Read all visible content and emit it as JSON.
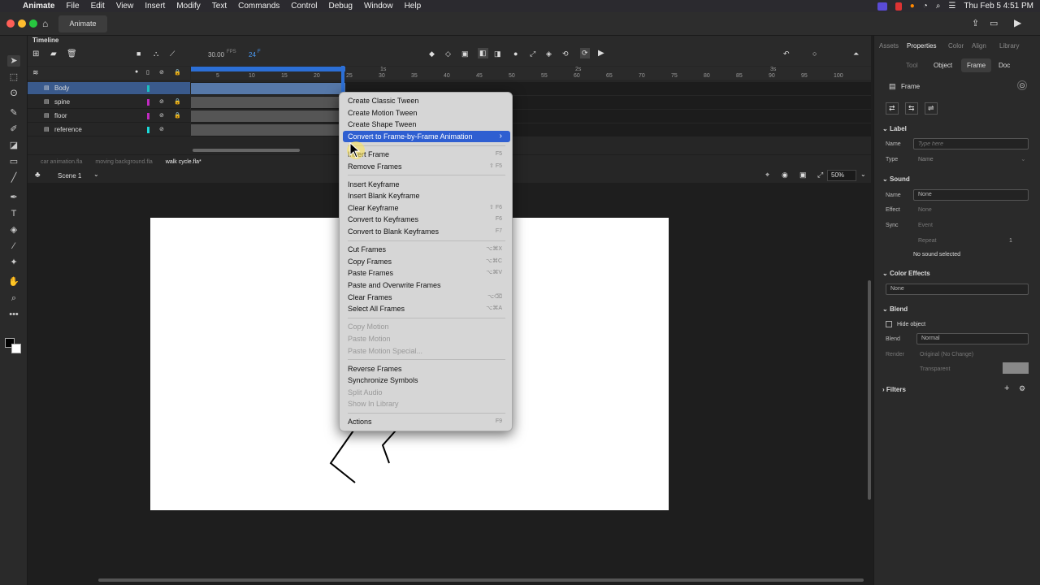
{
  "menubar": {
    "app": "Animate",
    "items": [
      "File",
      "Edit",
      "View",
      "Insert",
      "Modify",
      "Text",
      "Commands",
      "Control",
      "Debug",
      "Window",
      "Help"
    ],
    "datetime": "Thu Feb 5  4:51 PM"
  },
  "titlebar": {
    "tab": "Animate"
  },
  "timeline": {
    "title": "Timeline",
    "fps": "30.00",
    "fps_unit": "FPS",
    "frame": "24",
    "frame_unit": "F",
    "ruler": [
      "5",
      "10",
      "15",
      "20",
      "25",
      "30",
      "35",
      "40",
      "45",
      "50",
      "55",
      "60",
      "65",
      "70",
      "75",
      "80",
      "85",
      "90",
      "95",
      "100"
    ],
    "seconds": [
      "1s",
      "2s",
      "3s"
    ],
    "layers": [
      {
        "name": "Body",
        "color": "#1bbfbf",
        "selected": true
      },
      {
        "name": "spine",
        "color": "#c02ac0",
        "selected": false
      },
      {
        "name": "floor",
        "color": "#c02ac0",
        "selected": false
      },
      {
        "name": "reference",
        "color": "#1bdada",
        "selected": false
      }
    ]
  },
  "docs": {
    "tabs": [
      "car animation.fla",
      "moving background.fla",
      "walk cycle.fla*"
    ]
  },
  "scene": {
    "name": "Scene 1",
    "zoom": "50%"
  },
  "props": {
    "tabs": [
      "Assets",
      "Properties",
      "Color",
      "Align",
      "Library"
    ],
    "subtabs": [
      "Tool",
      "Object",
      "Frame",
      "Doc"
    ],
    "frame_label": "Frame",
    "label_section": "Label",
    "name_label": "Name",
    "name_placeholder": "Type here",
    "type_label": "Type",
    "type_value": "Name",
    "sound_section": "Sound",
    "sound_name_label": "Name",
    "sound_name_value": "None",
    "effect_label": "Effect",
    "effect_value": "None",
    "sync_label": "Sync",
    "sync_value": "Event",
    "repeat_value": "Repeat",
    "repeat_count": "1",
    "no_sound": "No sound selected",
    "color_effects": "Color Effects",
    "color_value": "None",
    "blend_section": "Blend",
    "hide_object": "Hide object",
    "blend_label": "Blend",
    "blend_value": "Normal",
    "render_label": "Render",
    "render_value": "Original (No Change)",
    "transparent": "Transparent",
    "filters": "Filters"
  },
  "context_menu": [
    {
      "label": "Create Classic Tween",
      "shortcut": "",
      "disabled": false
    },
    {
      "label": "Create Motion Tween",
      "shortcut": "",
      "disabled": false
    },
    {
      "label": "Create Shape Tween",
      "shortcut": "",
      "disabled": false
    },
    {
      "label": "Convert to Frame-by-Frame Animation",
      "shortcut": "›",
      "disabled": false,
      "highlight": true
    },
    {
      "sep": true
    },
    {
      "label": "Insert Frame",
      "shortcut": "F5",
      "disabled": false
    },
    {
      "label": "Remove Frames",
      "shortcut": "⇧ F5",
      "disabled": false
    },
    {
      "sep": true
    },
    {
      "label": "Insert Keyframe",
      "shortcut": "",
      "disabled": false
    },
    {
      "label": "Insert Blank Keyframe",
      "shortcut": "",
      "disabled": false
    },
    {
      "label": "Clear Keyframe",
      "shortcut": "⇧ F6",
      "disabled": false
    },
    {
      "label": "Convert to Keyframes",
      "shortcut": "F6",
      "disabled": false
    },
    {
      "label": "Convert to Blank Keyframes",
      "shortcut": "F7",
      "disabled": false
    },
    {
      "sep": true
    },
    {
      "label": "Cut Frames",
      "shortcut": "⌥⌘X",
      "disabled": false
    },
    {
      "label": "Copy Frames",
      "shortcut": "⌥⌘C",
      "disabled": false
    },
    {
      "label": "Paste Frames",
      "shortcut": "⌥⌘V",
      "disabled": false
    },
    {
      "label": "Paste and Overwrite Frames",
      "shortcut": "",
      "disabled": false
    },
    {
      "label": "Clear Frames",
      "shortcut": "⌥⌫",
      "disabled": false
    },
    {
      "label": "Select All Frames",
      "shortcut": "⌥⌘A",
      "disabled": false
    },
    {
      "sep": true
    },
    {
      "label": "Copy Motion",
      "shortcut": "",
      "disabled": true
    },
    {
      "label": "Paste Motion",
      "shortcut": "",
      "disabled": true
    },
    {
      "label": "Paste Motion Special...",
      "shortcut": "",
      "disabled": true
    },
    {
      "sep": true
    },
    {
      "label": "Reverse Frames",
      "shortcut": "",
      "disabled": false
    },
    {
      "label": "Synchronize Symbols",
      "shortcut": "",
      "disabled": false
    },
    {
      "label": "Split Audio",
      "shortcut": "",
      "disabled": true
    },
    {
      "label": "Show In Library",
      "shortcut": "",
      "disabled": true
    },
    {
      "sep": true
    },
    {
      "label": "Actions",
      "shortcut": "F9",
      "disabled": false
    }
  ]
}
